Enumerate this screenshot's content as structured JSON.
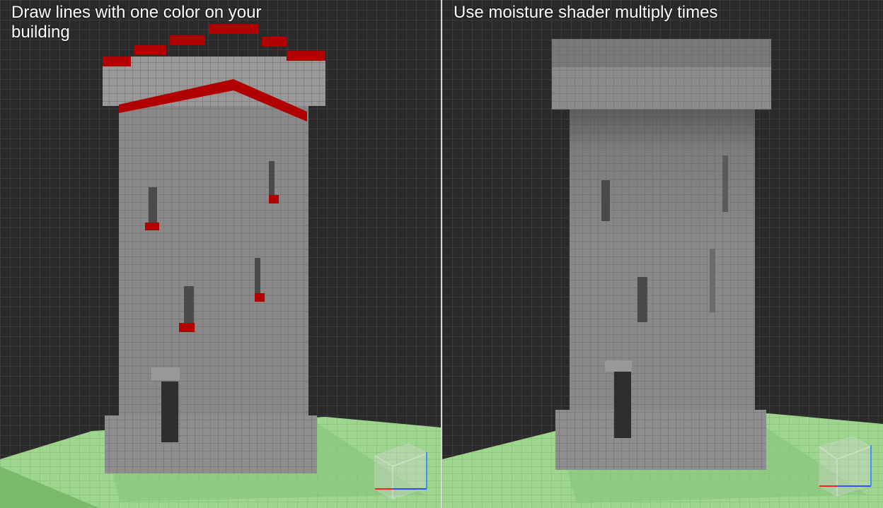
{
  "panels": [
    {
      "id": "left",
      "caption": "Draw lines with one color on your building",
      "shading": "flat",
      "accent_color": "#b00000"
    },
    {
      "id": "right",
      "caption": "Use moisture shader multiply times",
      "shading": "moisture",
      "accent_color": "#3c3c3c"
    }
  ],
  "colors": {
    "background": "#262626",
    "grid_line": "#4a4a4a",
    "wall_front": "#8a8888",
    "wall_side": "#9c9a9a",
    "ground": "#9fd68f",
    "accent_red": "#b00000"
  },
  "icons": {
    "view_cube": "view-cube-icon"
  }
}
